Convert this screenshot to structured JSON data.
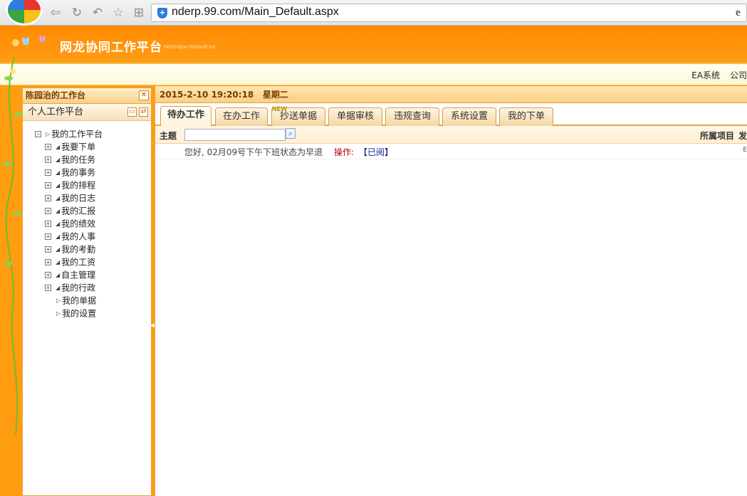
{
  "browser": {
    "url": "nderp.99.com/Main_Default.aspx",
    "ie_icon": "e"
  },
  "header": {
    "title": "网龙协同工作平台",
    "subtitle": "NetDragon Websoft Inc"
  },
  "top_links": [
    "EA系统",
    "公司"
  ],
  "left_panel": {
    "title": "陈园治的工作台",
    "section": "个人工作平台",
    "tree_root": "我的工作平台",
    "expandable_items": [
      "我要下单",
      "我的任务",
      "我的事务",
      "我的排程",
      "我的日志",
      "我的汇报",
      "我的绩效",
      "我的人事",
      "我的考勤",
      "我的工资",
      "自主管理",
      "我的行政"
    ],
    "leaf_items": [
      "我的单据",
      "我的设置"
    ]
  },
  "main": {
    "datetime": "2015-2-10 19:20:18",
    "weekday": "星期二",
    "tabs": [
      "待办工作",
      "在办工作",
      "抄送单据",
      "单据审核",
      "违规查询",
      "系统设置",
      "我的下单"
    ],
    "new_badge": "NEW",
    "filter": {
      "subject_label": "主题",
      "subject_value": "",
      "project_label": "所属项目",
      "project_tail": "发"
    },
    "tasks": [
      {
        "text": "您好, 02月09号下午下班状态为早退",
        "op_label": "操作:",
        "op_link": "【已阅】",
        "tail": "E"
      }
    ]
  },
  "colors": {
    "accent": "#ff9c10",
    "panel_border": "#e8a33c",
    "op_red": "#c00000",
    "link_blue": "#0a1e8c"
  }
}
